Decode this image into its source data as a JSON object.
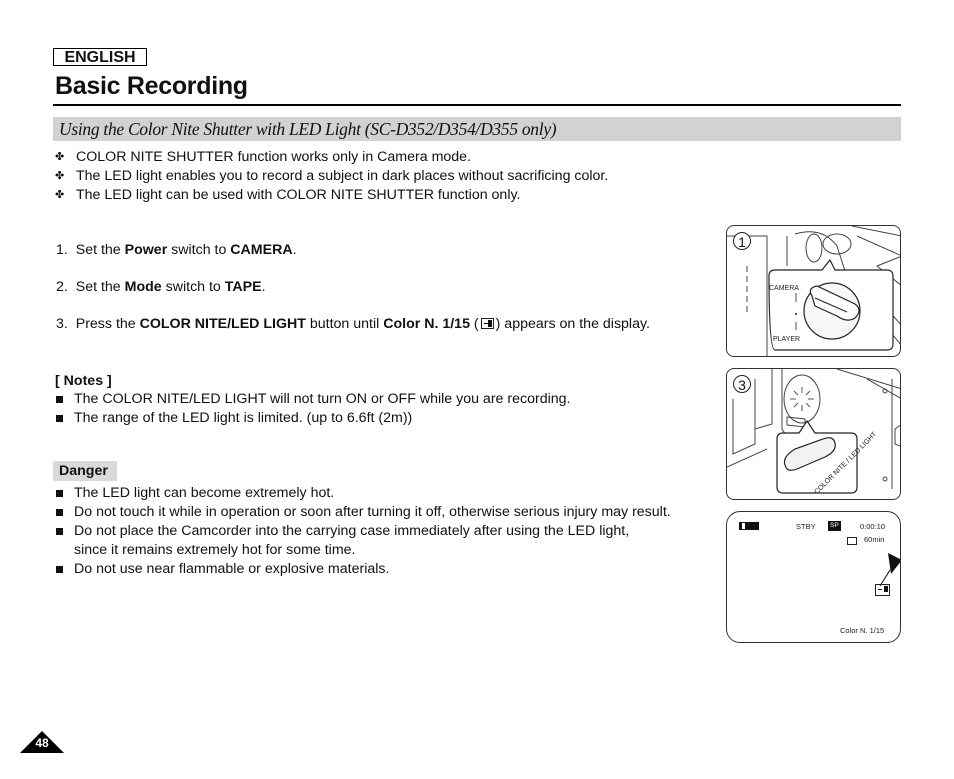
{
  "header": {
    "language": "ENGLISH",
    "title": "Basic Recording"
  },
  "section": {
    "title": "Using the Color Nite Shutter with LED Light (SC-D352/D354/D355 only)"
  },
  "intro": {
    "bullet_icon": "cross-bullet-icon",
    "items": [
      "COLOR NITE SHUTTER function works only in Camera mode.",
      "The LED light enables you to record a subject in dark places without sacrificing color.",
      "The LED light can be used with COLOR NITE SHUTTER function only."
    ]
  },
  "steps": [
    {
      "num": "1.",
      "pre": "Set the ",
      "b1": "Power",
      "mid": " switch to ",
      "b2": "CAMERA",
      "post": "."
    },
    {
      "num": "2.",
      "pre": "Set the ",
      "b1": "Mode",
      "mid": " switch to ",
      "b2": "TAPE",
      "post": "."
    },
    {
      "num": "3.",
      "pre": "Press the ",
      "b1": "COLOR NITE/LED LIGHT",
      "mid": " button until ",
      "b2": "Color N. 1/15",
      "open": " (",
      "icon": "color-nite-icon",
      "post": ") appears on the display."
    }
  ],
  "notes": {
    "heading": "[ Notes ]",
    "items": [
      "The COLOR NITE/LED LIGHT will not turn ON or OFF while you are recording.",
      "The range of the LED light is limited. (up to 6.6ft (2m))"
    ]
  },
  "danger": {
    "label": "Danger",
    "items": [
      "The LED light can become extremely hot.",
      "Do not touch it while in operation or soon after turning it off, otherwise serious injury may result.",
      "Do not place the Camcorder into the carrying case immediately after using the LED light,",
      "since it remains extremely hot for some time.",
      "Do not use near flammable or explosive materials."
    ]
  },
  "figures": {
    "fig1": {
      "number": "1",
      "label_top": "CAMERA",
      "label_bottom": "PLAYER"
    },
    "fig3": {
      "number": "3",
      "label": "COLOR NITE / LED LIGHT"
    },
    "screen": {
      "status": "STBY",
      "mode": "SP",
      "timecode": "0:00:10",
      "remaining": "60min",
      "color_nite": "Color N. 1/15"
    }
  },
  "footer": {
    "page_number": "48"
  }
}
